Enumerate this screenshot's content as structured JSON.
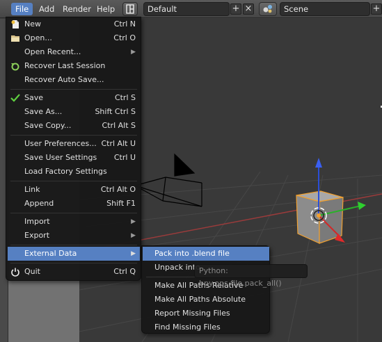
{
  "topbar": {
    "menus": [
      "File",
      "Add",
      "Render",
      "Help"
    ],
    "screen_layout": "Default",
    "scene": "Scene"
  },
  "file_menu": {
    "items": [
      {
        "label": "New",
        "shortcut": "Ctrl N"
      },
      {
        "label": "Open...",
        "shortcut": "Ctrl O"
      },
      {
        "label": "Open Recent...",
        "shortcut": ""
      },
      {
        "label": "Recover Last Session",
        "shortcut": ""
      },
      {
        "label": "Recover Auto Save...",
        "shortcut": ""
      },
      {
        "label": "Save",
        "shortcut": "Ctrl S"
      },
      {
        "label": "Save As...",
        "shortcut": "Shift Ctrl S"
      },
      {
        "label": "Save Copy...",
        "shortcut": "Ctrl Alt S"
      },
      {
        "label": "User Preferences...",
        "shortcut": "Ctrl Alt U"
      },
      {
        "label": "Save User Settings",
        "shortcut": "Ctrl U"
      },
      {
        "label": "Load Factory Settings",
        "shortcut": ""
      },
      {
        "label": "Link",
        "shortcut": "Ctrl Alt O"
      },
      {
        "label": "Append",
        "shortcut": "Shift F1"
      },
      {
        "label": "Import",
        "shortcut": ""
      },
      {
        "label": "Export",
        "shortcut": ""
      },
      {
        "label": "External Data",
        "shortcut": ""
      },
      {
        "label": "Quit",
        "shortcut": "Ctrl Q"
      }
    ]
  },
  "external_data_menu": {
    "items": [
      "Pack into .blend file",
      "Unpack into",
      "Make All Paths Relative",
      "Make All Paths Absolute",
      "Report Missing Files",
      "Find Missing Files"
    ]
  },
  "tooltip": "Python: bpy.ops.file.pack_all()",
  "colors": {
    "highlight": "#5680c2",
    "menu_bg": "#181818",
    "viewport_bg": "#393939"
  }
}
